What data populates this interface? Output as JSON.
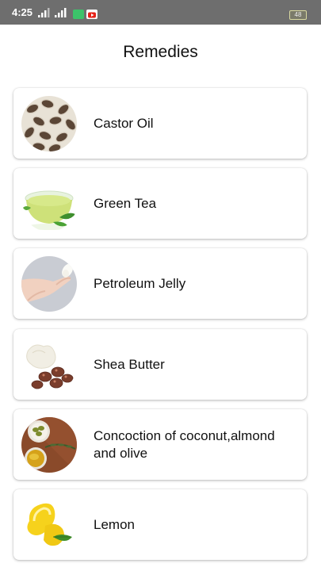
{
  "status_bar": {
    "time": "4:25",
    "battery": "48",
    "icons": [
      "signal-icon",
      "signal-icon",
      "message-app-icon",
      "youtube-icon",
      "battery-icon"
    ]
  },
  "header": {
    "title": "Remedies"
  },
  "remedies": [
    {
      "label": "Castor Oil",
      "icon": "castor-seeds-image"
    },
    {
      "label": "Green Tea",
      "icon": "green-tea-image"
    },
    {
      "label": "Petroleum Jelly",
      "icon": "petroleum-jelly-image"
    },
    {
      "label": "Shea Butter",
      "icon": "shea-butter-image"
    },
    {
      "label": "Concoction of coconut,almond and olive",
      "icon": "olive-oil-image"
    },
    {
      "label": "Lemon",
      "icon": "lemon-image"
    }
  ]
}
